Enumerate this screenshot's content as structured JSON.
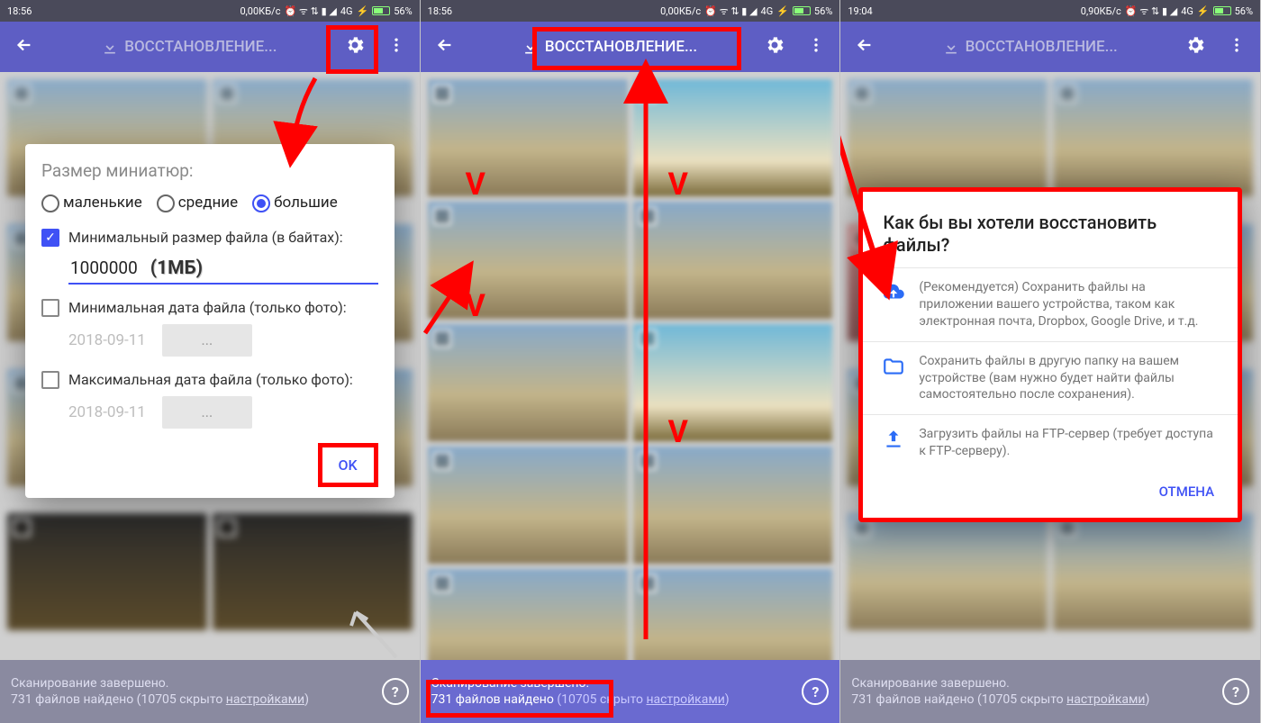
{
  "status": {
    "time1": "18:56",
    "time2": "18:56",
    "time3": "19:04",
    "net1": "0,00КБ/с",
    "net3": "0,90КБ/с",
    "cell": "4G",
    "battery": "56%"
  },
  "appbar": {
    "title": "ВОССТАНОВЛЕНИЕ..."
  },
  "dialog1": {
    "title": "Размер миниатюр:",
    "radio_small": "маленькие",
    "radio_med": "средние",
    "radio_big": "большие",
    "min_size_label": "Минимальный размер файла (в байтах):",
    "min_size_value": "1000000",
    "min_size_hint": "(1МБ)",
    "min_date_label": "Минимальная дата файла (только фото):",
    "max_date_label": "Максимальная дата файла (только фото):",
    "date_value": "2018-09-11",
    "date_btn": "...",
    "ok": "OK"
  },
  "bottom": {
    "line1": "Сканирование завершено.",
    "line2a": "731 файлов найдено",
    "line2b": " (10705 скрыто ",
    "settings_link": "настройками",
    "tail": ")"
  },
  "dialog3": {
    "title": "Как бы вы хотели восстановить файлы?",
    "opt1": "(Рекомендуется) Сохранить файлы на приложении вашего устройства, таком как электронная почта, Dropbox, Google Drive, и т.д.",
    "opt2": "Сохранить файлы в другую папку на вашем устройстве (вам нужно будет найти файлы самостоятельно после сохранения).",
    "opt3": "Загрузить файлы на FTP-сервер (требует доступа к FTP-серверу).",
    "cancel": "ОТМЕНА"
  }
}
